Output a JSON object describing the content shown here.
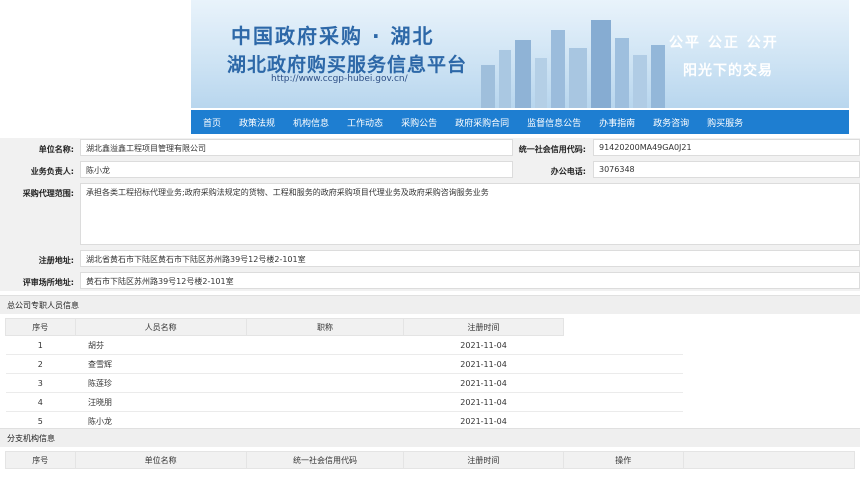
{
  "banner": {
    "title_line1": "中国政府采购 · 湖北",
    "title_line2": "湖北政府购买服务信息平台",
    "url": "http://www.ccgp-hubei.gov.cn/",
    "slogan_line1": "公平  公正  公开",
    "slogan_line2": "阳光下的交易"
  },
  "nav": {
    "items": [
      "首页",
      "政策法规",
      "机构信息",
      "工作动态",
      "采购公告",
      "政府采购合同",
      "监督信息公告",
      "办事指南",
      "政务咨询",
      "购买服务"
    ]
  },
  "info": {
    "unit_name_label": "单位名称:",
    "unit_name": "湖北鑫溢鑫工程项目管理有限公司",
    "credit_code_label": "统一社会信用代码:",
    "credit_code": "91420200MA49GA0J21",
    "manager_label": "业务负责人:",
    "manager": "陈小龙",
    "phone_label": "办公电话:",
    "phone": "3076348",
    "scope_label": "采购代理范围:",
    "scope": "承担各类工程招标代理业务;政府采购法规定的货物、工程和服务的政府采购项目代理业务及政府采购咨询服务业务",
    "reg_address_label": "注册地址:",
    "reg_address": "湖北省黄石市下陆区黄石市下陆区苏州路39号12号楼2-101室",
    "venue_label": "评审场所地址:",
    "venue": "黄石市下陆区苏州路39号12号楼2-101室"
  },
  "staff": {
    "section_title": "总公司专职人员信息",
    "headers": [
      "序号",
      "人员名称",
      "职称",
      "注册时间"
    ],
    "rows": [
      {
        "no": "1",
        "name": "胡芬",
        "title": "",
        "date": "2021-11-04"
      },
      {
        "no": "2",
        "name": "查雪辉",
        "title": "",
        "date": "2021-11-04"
      },
      {
        "no": "3",
        "name": "陈莲珍",
        "title": "",
        "date": "2021-11-04"
      },
      {
        "no": "4",
        "name": "汪晓朋",
        "title": "",
        "date": "2021-11-04"
      },
      {
        "no": "5",
        "name": "陈小龙",
        "title": "",
        "date": "2021-11-04"
      }
    ]
  },
  "branches": {
    "section_title": "分支机构信息",
    "headers": [
      "序号",
      "单位名称",
      "统一社会信用代码",
      "注册时间",
      "操作"
    ]
  },
  "colors": {
    "nav_bg": "#1e7ed1",
    "brand_text": "#2d68a8"
  }
}
